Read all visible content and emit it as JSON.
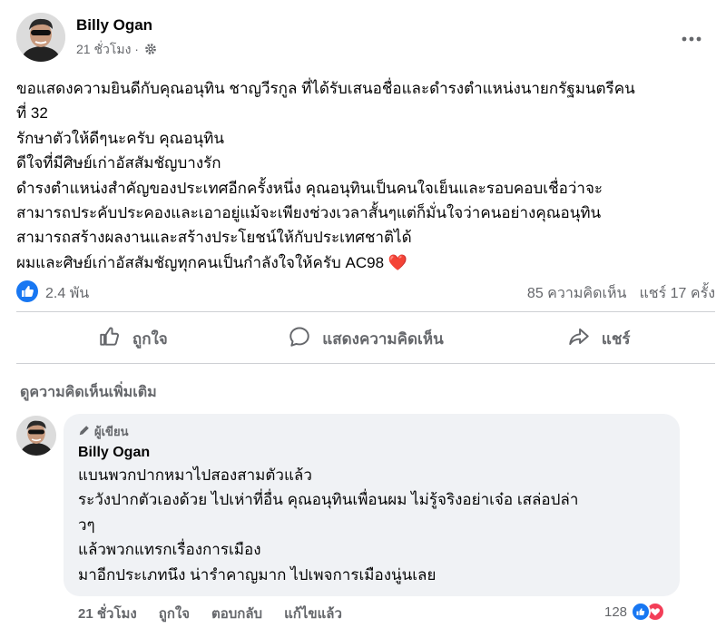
{
  "post": {
    "author": "Billy Ogan",
    "time": "21 ชั่วโมง ·",
    "privacy_icon": "gear-icon",
    "body": [
      "ขอแสดงความยินดีกับคุณอนุทิน ชาญวีรกูล ที่ได้รับเสนอชื่อและดำรงตำแหน่งนายกรัฐมนตรีคน",
      "ที่ 32",
      "รักษาตัวให้ดีๆนะครับ คุณอนุทิน",
      "ดีใจที่มีศิษย์เก่าอัสสัมชัญบางรัก",
      "ดำรงตำแหน่งสำคัญของประเทศอีกครั้งหนึ่ง คุณอนุทินเป็นคนใจเย็นและรอบคอบเชื่อว่าจะ",
      "สามารถประคับประคองและเอาอยู่แม้จะเพียงช่วงเวลาสั้นๆแต่ก็มั่นใจว่าคนอย่างคุณอนุทิน",
      "สามารถสร้างผลงานและสร้างประโยชน์ให้กับประเทศชาติได้",
      "ผมและศิษย์เก่าอัสสัมชัญทุกคนเป็นกำลังใจให้ครับ AC98 ❤️"
    ]
  },
  "stats": {
    "likes": "2.4 พัน",
    "comments": "85 ความคิดเห็น",
    "shares": "แชร์ 17 ครั้ง"
  },
  "actions": {
    "like": "ถูกใจ",
    "comment": "แสดงความคิดเห็น",
    "share": "แชร์"
  },
  "more_comments": "ดูความคิดเห็นเพิ่มเติม",
  "comment": {
    "badge": "ผู้เขียน",
    "author": "Billy Ogan",
    "lines": [
      "แบนพวกปากหมาไปสองสามตัวแล้ว",
      "ระวังปากตัวเองด้วย ไปเห่าที่อื่น คุณอนุทินเพื่อนผม ไม่รู้จริงอย่าเจ๋อ เสล่อปล่า",
      "วๆ",
      "แล้วพวกแทรกเรื่องการเมือง",
      "มาอีกประเภทนึง น่ารำคาญมาก ไปเพจการเมืองนู่นเลย"
    ],
    "time": "21 ชั่วโมง",
    "like": "ถูกใจ",
    "reply": "ตอบกลับ",
    "edited": "แก้ไขแล้ว",
    "reactions": "128"
  },
  "colors": {
    "like_blue": "#1877f2",
    "love_red": "#f33e58",
    "secondary_text": "#65676b",
    "bubble_bg": "#f0f2f5"
  }
}
